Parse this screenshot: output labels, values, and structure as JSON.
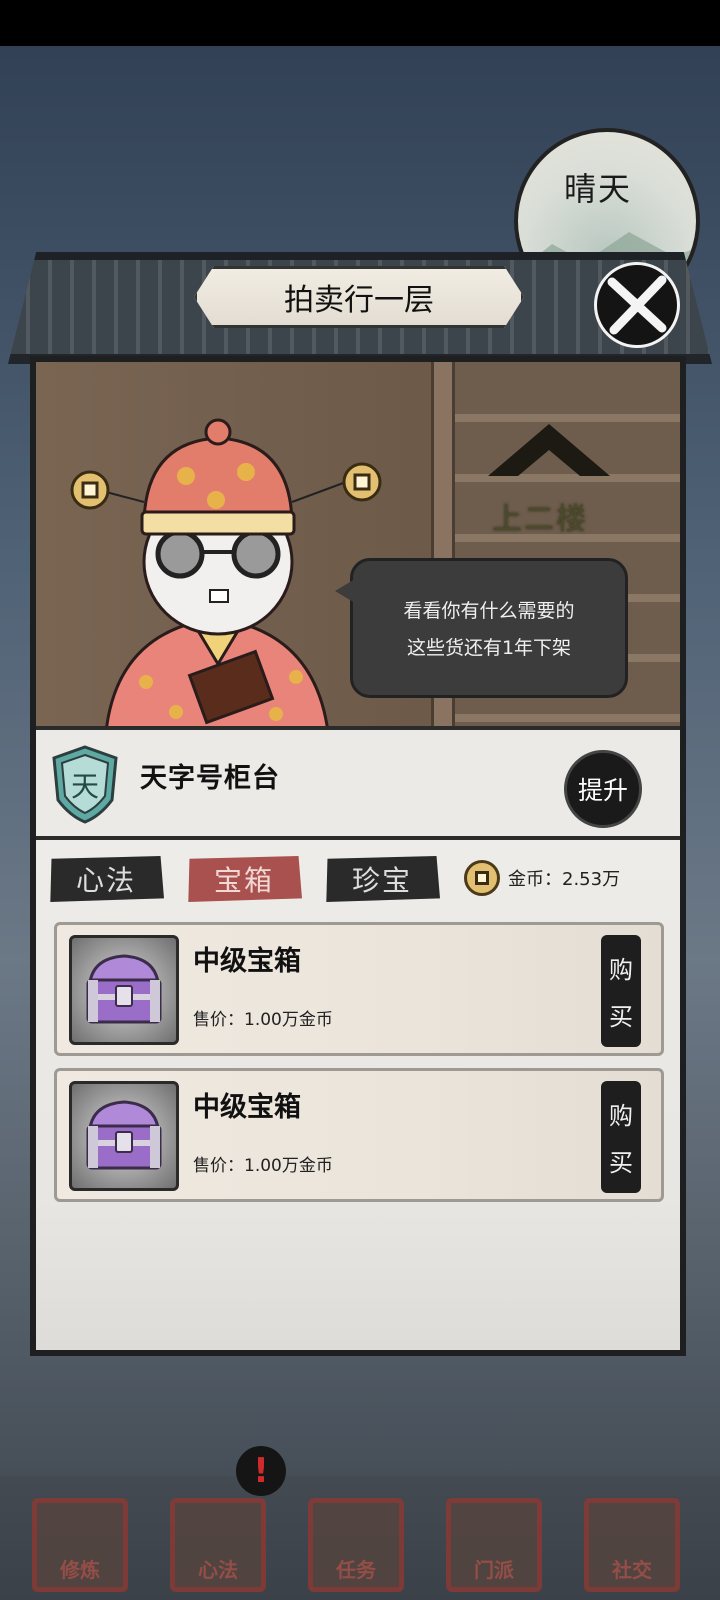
{
  "weather": {
    "label": "晴天"
  },
  "header": {
    "title": "拍卖行一层"
  },
  "shop": {
    "upstairs_label": "上二楼",
    "speech_line1": "看看你有什么需要的",
    "speech_line2": "这些货还有1年下架"
  },
  "counter": {
    "badge_char": "天",
    "title": "天字号柜台",
    "upgrade_label": "提升"
  },
  "tabs": [
    {
      "label": "心法",
      "active": false
    },
    {
      "label": "宝箱",
      "active": true
    },
    {
      "label": "珍宝",
      "active": false
    }
  ],
  "currency": {
    "label": "金币：2.53万"
  },
  "items": [
    {
      "name": "中级宝箱",
      "price": "售价：1.00万金币",
      "buy_char1": "购",
      "buy_char2": "买"
    },
    {
      "name": "中级宝箱",
      "price": "售价：1.00万金币",
      "buy_char1": "购",
      "buy_char2": "买"
    }
  ],
  "nav": [
    {
      "label": "修炼",
      "icon": "cultivation-icon"
    },
    {
      "label": "心法",
      "icon": "scroll-icon"
    },
    {
      "label": "任务",
      "icon": "quest-icon"
    },
    {
      "label": "门派",
      "icon": "sect-icon"
    },
    {
      "label": "社交",
      "icon": "social-icon"
    }
  ],
  "colors": {
    "active_tab": "#a8514f",
    "badge": "#5fa9a4"
  }
}
